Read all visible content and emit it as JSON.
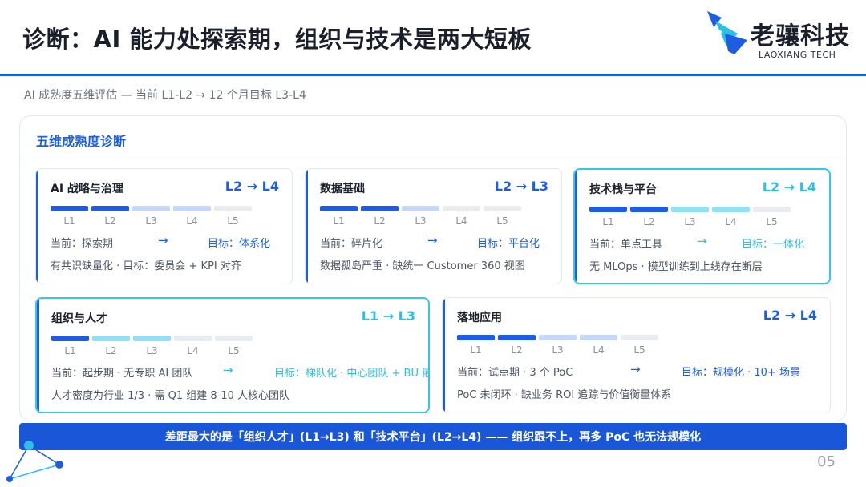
{
  "header": {
    "title": "诊断：AI 能力处探索期，组织与技术是两大短板",
    "brand_name": "老骧科技",
    "brand_sub": "LAOXIANG TECH"
  },
  "subtitle": "AI 成熟度五维评估 — 当前 L1-L2 → 12 个月目标 L3-L4",
  "panel": {
    "title": "五维成熟度诊断",
    "level_labels": [
      "L1",
      "L2",
      "L3",
      "L4",
      "L5"
    ],
    "arrow": "→",
    "cards": [
      {
        "title": "AI 战略与治理",
        "range": "L2 → L4",
        "current_text": "当前：探索期",
        "target_text": "目标：体系化",
        "note": "有共识缺量化 · 目标：委员会 + KPI 对齐",
        "current_level": 2,
        "target_level": 4,
        "highlighted": false
      },
      {
        "title": "数据基础",
        "range": "L2 → L3",
        "current_text": "当前：碎片化",
        "target_text": "目标：平台化",
        "note": "数据孤岛严重 · 缺统一 Customer 360 视图",
        "current_level": 2,
        "target_level": 3,
        "highlighted": false
      },
      {
        "title": "技术栈与平台",
        "range": "L2 → L4",
        "current_text": "当前：单点工具",
        "target_text": "目标：一体化",
        "note": "无 MLOps · 模型训练到上线存在断层",
        "current_level": 2,
        "target_level": 4,
        "highlighted": true
      },
      {
        "title": "组织与人才",
        "range": "L1 → L3",
        "current_text": "当前：起步期 · 无专职 AI 团队",
        "target_text": "目标：梯队化 · 中心团队 + BU 嵌入",
        "note": "人才密度为行业 1/3 · 需 Q1 组建 8-10 人核心团队",
        "current_level": 1,
        "target_level": 3,
        "highlighted": true
      },
      {
        "title": "落地应用",
        "range": "L2 → L4",
        "current_text": "当前：试点期 · 3 个 PoC",
        "target_text": "目标：规模化 · 10+ 场景",
        "note": "PoC 未闭环 · 缺业务 ROI 追踪与价值衡量体系",
        "current_level": 2,
        "target_level": 4,
        "highlighted": false
      }
    ]
  },
  "banner": "差距最大的是「组织人才」(L1→L3) 和「技术平台」(L2→L4) —— 组织跟不上，再多 PoC 也无法规模化",
  "page_number": "05",
  "colors": {
    "accent": "#1d5ee0",
    "highlight": "#38c6e8",
    "banner": "#1a56d8"
  }
}
